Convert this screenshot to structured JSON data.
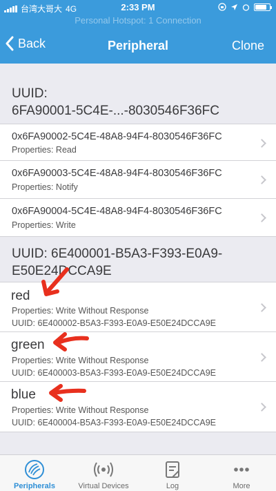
{
  "status_bar": {
    "carrier": "台湾大哥大",
    "network": "4G",
    "time": "2:33 PM",
    "hotspot": "Personal Hotspot: 1 Connection"
  },
  "nav": {
    "back_label": "Back",
    "title": "Peripheral",
    "clone_label": "Clone"
  },
  "services": [
    {
      "uuid_line1": "UUID:",
      "uuid_line2": "6FA90001-5C4E-...-8030546F36FC",
      "characteristics": [
        {
          "uuid": "0x6FA90002-5C4E-48A8-94F4-8030546F36FC",
          "properties": "Properties: Read"
        },
        {
          "uuid": "0x6FA90003-5C4E-48A8-94F4-8030546F36FC",
          "properties": "Properties: Notify"
        },
        {
          "uuid": "0x6FA90004-5C4E-48A8-94F4-8030546F36FC",
          "properties": "Properties: Write"
        }
      ]
    },
    {
      "uuid_line1": "UUID: 6E400001-B5A3-F393-E0A9-",
      "uuid_line2": "E50E24DCCA9E",
      "characteristics": [
        {
          "name": "red",
          "properties": "Properties: Write Without Response",
          "uuid": "UUID: 6E400002-B5A3-F393-E0A9-E50E24DCCA9E"
        },
        {
          "name": "green",
          "properties": "Properties: Write Without Response",
          "uuid": "UUID: 6E400003-B5A3-F393-E0A9-E50E24DCCA9E"
        },
        {
          "name": "blue",
          "properties": "Properties: Write Without Response",
          "uuid": "UUID: 6E400004-B5A3-F393-E0A9-E50E24DCCA9E"
        }
      ]
    }
  ],
  "tabs": [
    {
      "label": "Peripherals",
      "icon": "peripherals-icon",
      "active": true
    },
    {
      "label": "Virtual Devices",
      "icon": "broadcast-icon",
      "active": false
    },
    {
      "label": "Log",
      "icon": "log-icon",
      "active": false
    },
    {
      "label": "More",
      "icon": "more-icon",
      "active": false
    }
  ],
  "colors": {
    "nav_blue": "#3b9bdc",
    "annotation_red": "#e8301e",
    "tab_active": "#2f8fd6"
  }
}
